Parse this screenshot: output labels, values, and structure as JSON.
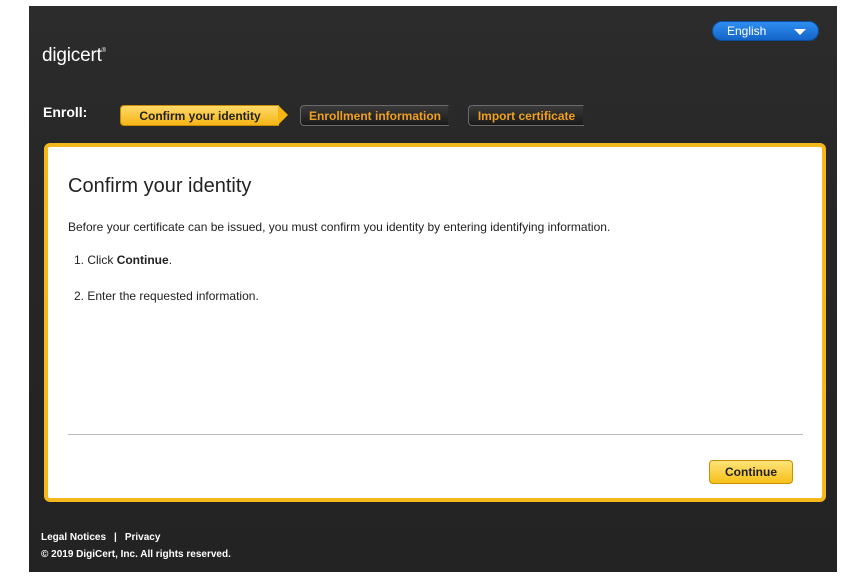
{
  "header": {
    "logo_text": "digicert",
    "logo_mark": "®",
    "language": "English"
  },
  "enroll": {
    "label": "Enroll:",
    "steps": [
      {
        "label": "Confirm your identity",
        "state": "active"
      },
      {
        "label": "Enrollment information",
        "state": "inactive"
      },
      {
        "label": "Import certificate",
        "state": "inactive"
      }
    ]
  },
  "card": {
    "title": "Confirm your identity",
    "intro": "Before your certificate can be issued, you must confirm you identity by entering identifying information.",
    "step1_prefix": "1. Click ",
    "step1_bold": "Continue",
    "step1_suffix": ".",
    "step2": "2. Enter the requested information.",
    "continue_label": "Continue"
  },
  "footer": {
    "legal": "Legal Notices",
    "separator": "|",
    "privacy": "Privacy",
    "copyright": "© 2019 DigiCert, Inc. All rights reserved."
  },
  "colors": {
    "accent": "#f4b81d",
    "language_button": "#1f77e0",
    "background": "#262626"
  }
}
